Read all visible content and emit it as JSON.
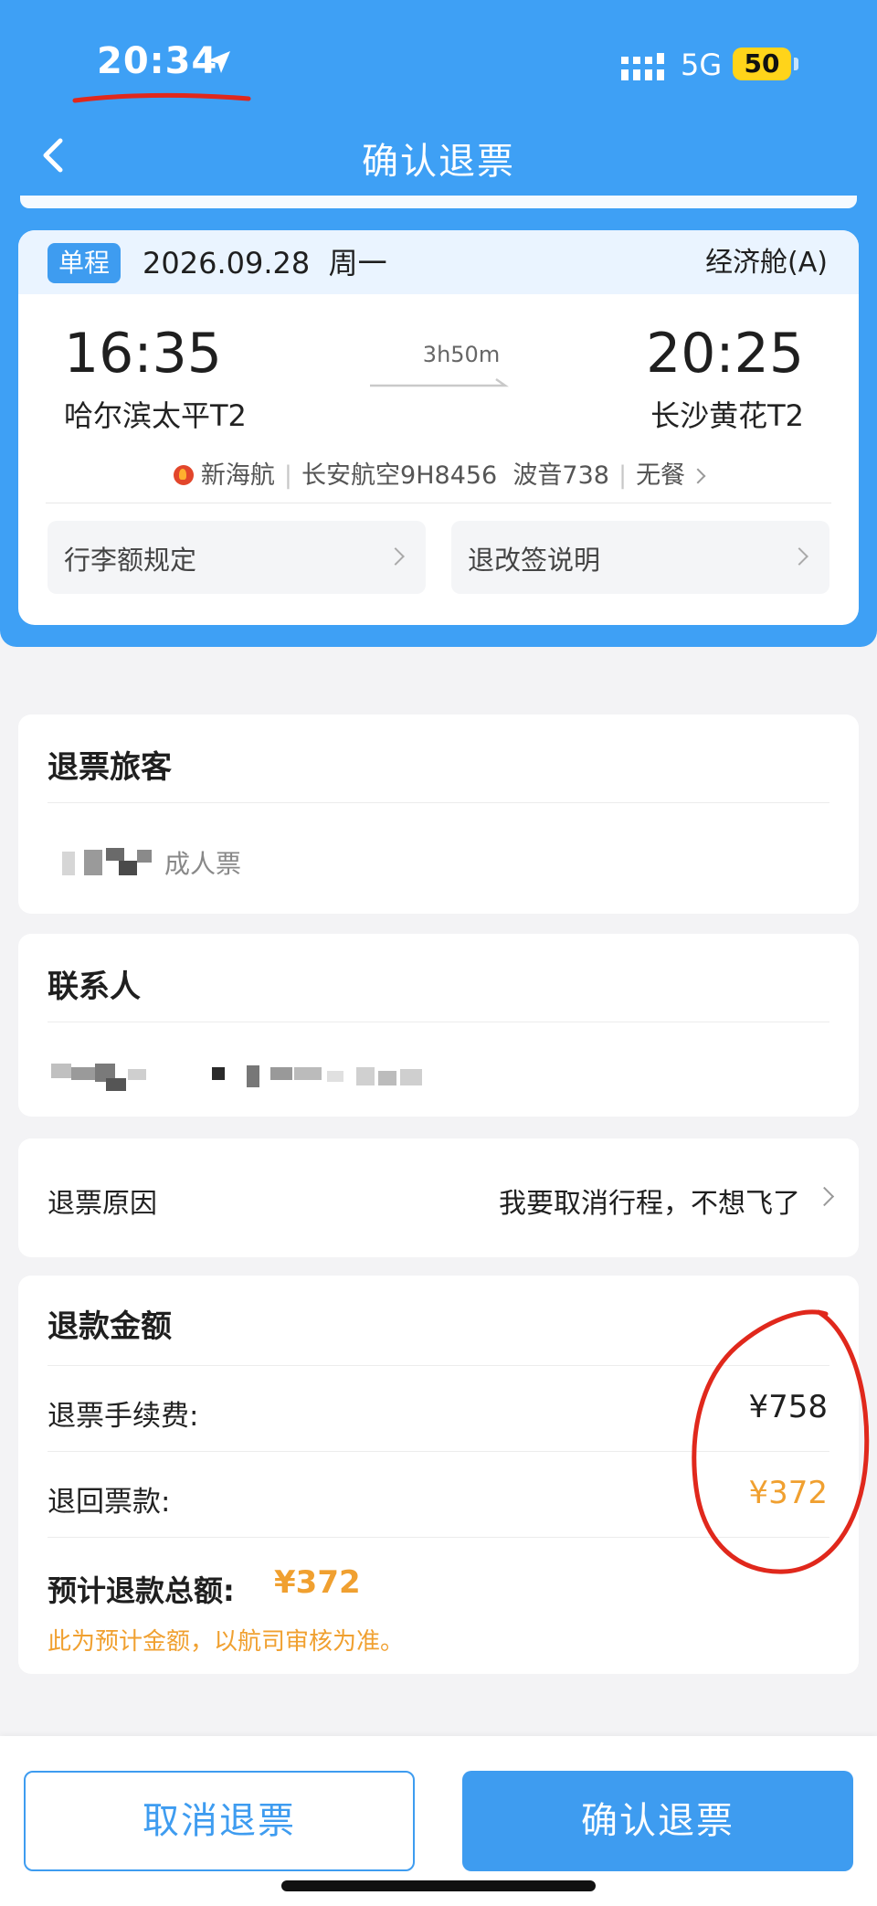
{
  "status_bar": {
    "time": "20:34",
    "network": "5G",
    "battery": "50",
    "icons": [
      "location-arrow-icon",
      "signal-bars-icon"
    ]
  },
  "nav": {
    "title": "确认退票",
    "back_icon": "chevron-left-icon"
  },
  "flight": {
    "trip_type": "单程",
    "date": "2026.09.28",
    "weekday": "周一",
    "cabin": "经济舱(A)",
    "departure_time": "16:35",
    "arrival_time": "20:25",
    "duration": "3h50m",
    "departure_airport": "哈尔滨太平T2",
    "arrival_airport": "长沙黄花T2",
    "airline": "新海航",
    "flight_no": "长安航空9H8456",
    "aircraft": "波音738",
    "meal": "无餐",
    "baggage_rules": "行李额规定",
    "refund_rules": "退改签说明"
  },
  "passengers": {
    "title": "退票旅客",
    "ticket_type": "成人票"
  },
  "contact": {
    "title": "联系人"
  },
  "reason": {
    "label": "退票原因",
    "value": "我要取消行程，不想飞了"
  },
  "refund": {
    "title": "退款金额",
    "fee_label": "退票手续费:",
    "fee_value": "¥758",
    "return_label": "退回票款:",
    "return_value": "¥372",
    "total_label": "预计退款总额:",
    "total_value": "¥372",
    "note": "此为预计金额，以航司审核为准。"
  },
  "actions": {
    "cancel": "取消退票",
    "confirm": "确认退票"
  },
  "colors": {
    "primary": "#3e9cf0",
    "accent": "#f0a030",
    "annotation": "#e0281c"
  }
}
